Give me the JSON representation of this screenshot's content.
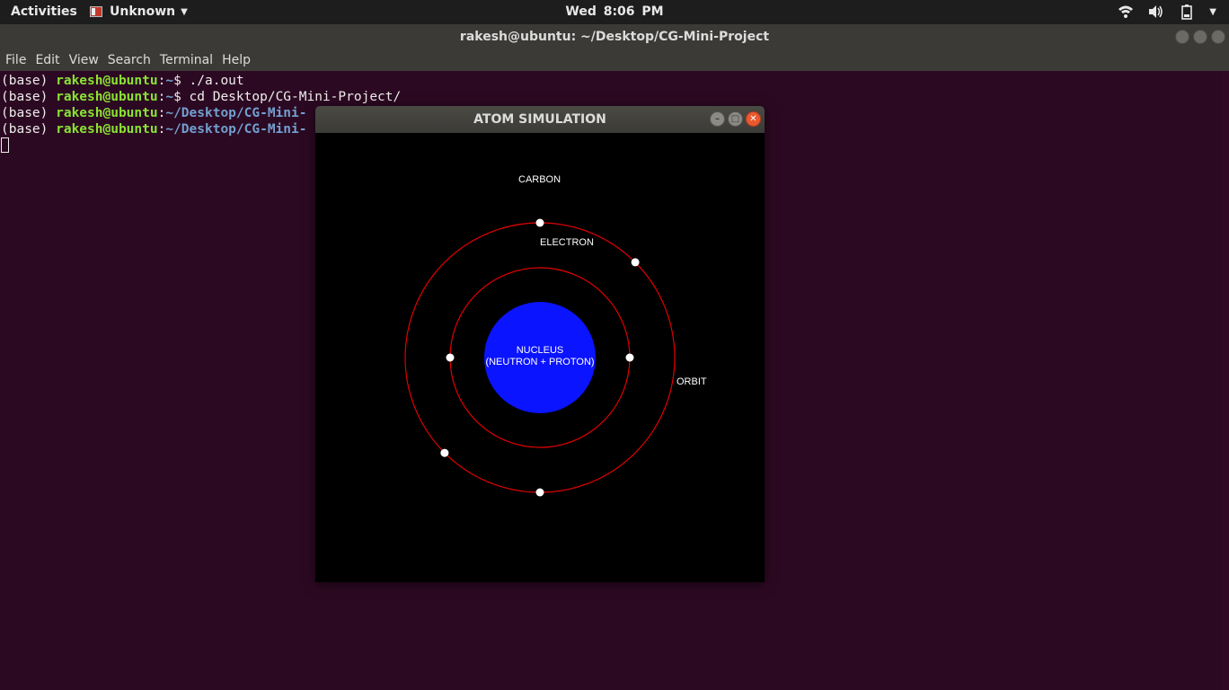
{
  "top_panel": {
    "activities": "Activities",
    "app_name": "Unknown",
    "clock": "Wed  8:06 PM",
    "icons": [
      "wifi-icon",
      "volume-icon",
      "battery-icon"
    ]
  },
  "terminal": {
    "title": "rakesh@ubuntu: ~/Desktop/CG-Mini-Project",
    "menu": [
      "File",
      "Edit",
      "View",
      "Search",
      "Terminal",
      "Help"
    ],
    "lines": [
      {
        "env": "(base) ",
        "user": "rakesh@ubuntu",
        "sep": ":",
        "path": "~",
        "cmd": "$ ./a.out"
      },
      {
        "env": "(base) ",
        "user": "rakesh@ubuntu",
        "sep": ":",
        "path": "~",
        "cmd": "$ cd Desktop/CG-Mini-Project/"
      },
      {
        "env": "(base) ",
        "user": "rakesh@ubuntu",
        "sep": ":",
        "path": "~/Desktop/CG-Mini-",
        "cmd": ""
      },
      {
        "env": "(base) ",
        "user": "rakesh@ubuntu",
        "sep": ":",
        "path": "~/Desktop/CG-Mini-",
        "cmd": ""
      }
    ],
    "colors": {
      "background": "#2c0922",
      "user": "#8ae234",
      "path": "#729fcf"
    }
  },
  "atom_window": {
    "title": "ATOM SIMULATION",
    "labels": {
      "element": "CARBON",
      "electron": "ELECTRON",
      "nucleus_line1": "NUCLEUS",
      "nucleus_line2": "(NEUTRON + PROTON)",
      "orbit": "ORBIT"
    },
    "colors": {
      "nucleus": "#0a14ff",
      "orbit": "#e10000",
      "electron": "#ffffff",
      "background": "#000000"
    },
    "orbits": [
      {
        "name": "inner",
        "electron_angles_deg": [
          0,
          180
        ]
      },
      {
        "name": "outer",
        "electron_angles_deg": [
          90,
          45,
          225,
          270
        ]
      }
    ]
  }
}
